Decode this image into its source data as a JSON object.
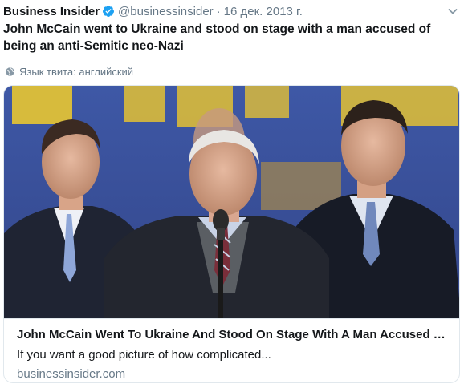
{
  "tweet": {
    "author_name": "Business Insider",
    "handle": "@businessinsider",
    "separator": "·",
    "date": "16 дек. 2013 г.",
    "text": "John McCain went to Ukraine and stood on stage with a man accused of being an anti-Semitic neo-Nazi",
    "language_note": "Язык твита: английский",
    "verified_color": "#1da1f2"
  },
  "card": {
    "title": "John McCain Went To Ukraine And Stood On Stage With A Man Accused Of Being An Anti-Semitic Neo-Nazi",
    "description": "If you want a good picture of how complicated...",
    "domain": "businessinsider.com"
  },
  "colors": {
    "text_primary": "#14171a",
    "text_secondary": "#657786",
    "border": "#e1e8ed"
  }
}
